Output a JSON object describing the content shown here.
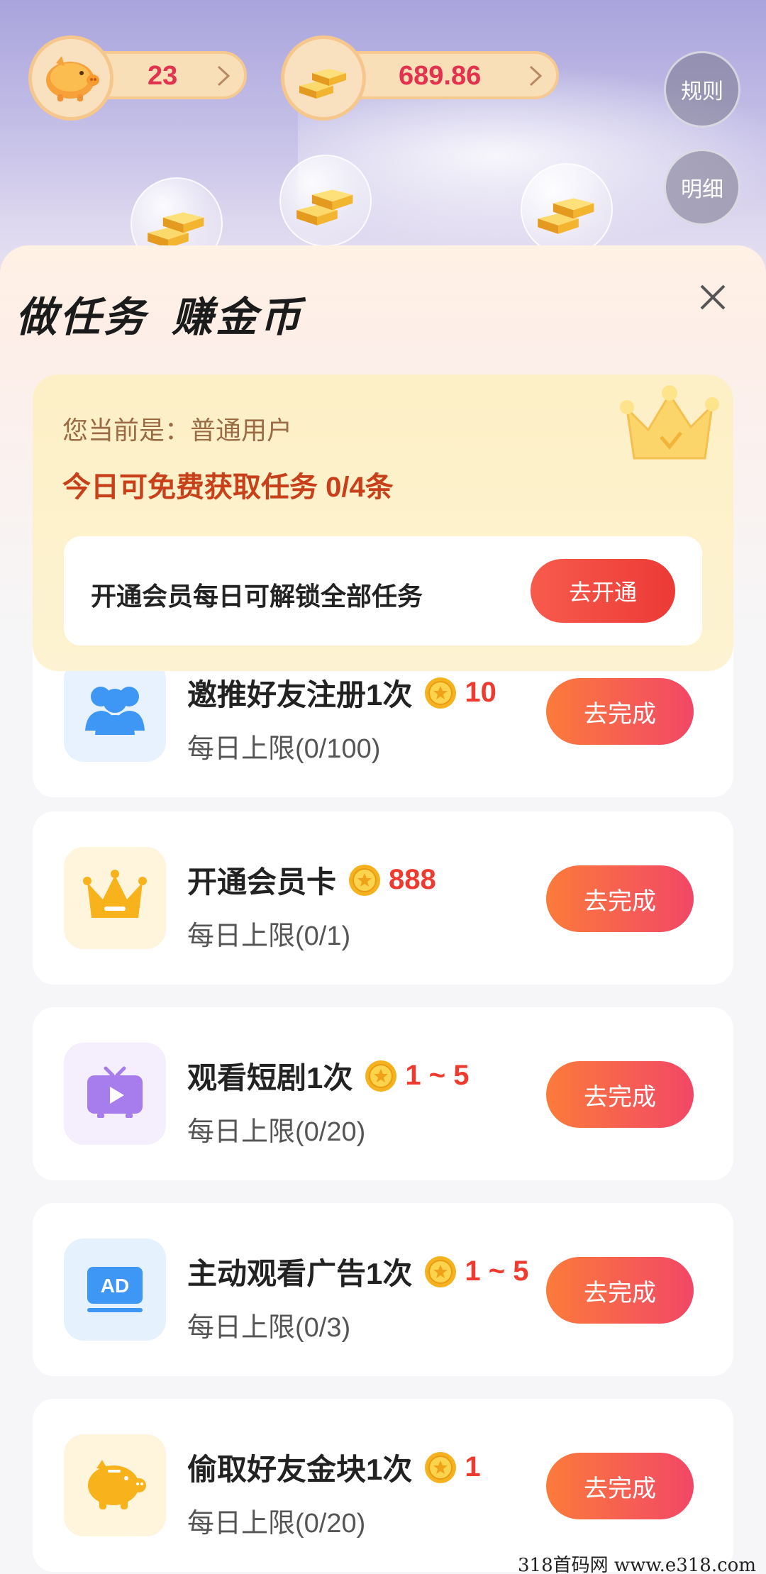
{
  "header": {
    "piggy_count": "23",
    "gold_amount": "689.86",
    "rules_label": "规则",
    "detail_label": "明细"
  },
  "sheet": {
    "title": "做任务  赚金币",
    "member": {
      "status": "您当前是：普通用户",
      "free_text": "今日可免费获取任务 0/4条",
      "unlock_text": "开通会员每日可解锁全部任务",
      "unlock_button": "去开通"
    }
  },
  "tasks": [
    {
      "name": "邀推好友注册1次",
      "reward": "10",
      "limit": "每日上限(0/100)",
      "button": "去完成",
      "icon": "users-icon",
      "icon_bg": "#e7f2fe",
      "icon_color": "#3f97f5"
    },
    {
      "name": "开通会员卡",
      "reward": "888",
      "limit": "每日上限(0/1)",
      "button": "去完成",
      "icon": "crown-icon",
      "icon_bg": "#fff4dc",
      "icon_color": "#f8b21b"
    },
    {
      "name": "观看短剧1次",
      "reward": "1 ~ 5",
      "limit": "每日上限(0/20)",
      "button": "去完成",
      "icon": "tv-play-icon",
      "icon_bg": "#f4eefd",
      "icon_color": "#a77ded"
    },
    {
      "name": "主动观看广告1次",
      "reward": "1 ~ 5",
      "limit": "每日上限(0/3)",
      "button": "去完成",
      "icon": "ad-icon",
      "icon_bg": "#e5f2fd",
      "icon_color": "#3f97f5"
    },
    {
      "name": "偷取好友金块1次",
      "reward": "1",
      "limit": "每日上限(0/20)",
      "button": "去完成",
      "icon": "piggy-icon",
      "icon_bg": "#fff4dc",
      "icon_color": "#f8b21b"
    }
  ],
  "watermark": "318首码网 www.e318.com"
}
